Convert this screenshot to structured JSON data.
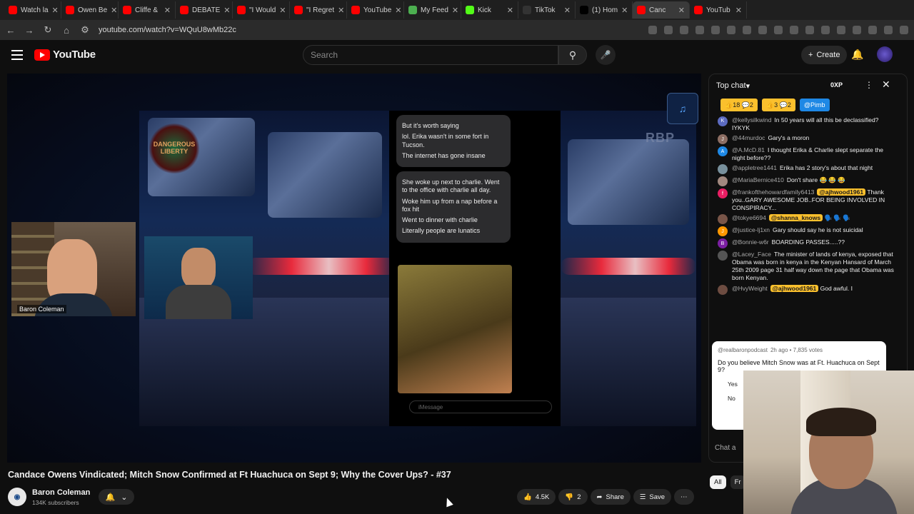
{
  "browser": {
    "tabs": [
      {
        "label": "Watch la",
        "color": "#ff0000"
      },
      {
        "label": "Owen Be",
        "color": "#ff0000"
      },
      {
        "label": "Cliffe &",
        "color": "#ff0000"
      },
      {
        "label": "DEBATE",
        "color": "#ff0000"
      },
      {
        "label": "\"I Would",
        "color": "#ff0000"
      },
      {
        "label": "\"I Regret",
        "color": "#ff0000"
      },
      {
        "label": "YouTube",
        "color": "#ff0000"
      },
      {
        "label": "My Feed",
        "color": "#4caf50"
      },
      {
        "label": "Kick",
        "color": "#53fc18"
      },
      {
        "label": "TikTok",
        "color": "#333333"
      },
      {
        "label": "(1) Hom",
        "color": "#000000"
      },
      {
        "label": "Canc",
        "color": "#ff0000"
      },
      {
        "label": "YouTub",
        "color": "#ff0000"
      }
    ],
    "url": "youtube.com/watch?v=WQuU8wMb22c"
  },
  "header": {
    "logo": "YouTube",
    "search_placeholder": "Search",
    "create_label": "Create"
  },
  "video": {
    "brand": "DANGEROUS LIBERTY",
    "watermark": "RBP",
    "cam1_label": "Baron Coleman",
    "phone": {
      "bubble1": [
        "But it's worth saying",
        "lol. Erika wasn't in some fort in Tucson.",
        "The internet has gone insane"
      ],
      "bubble2": [
        "She woke up next to charlie. Went to the office with charlie all day.",
        "Woke him up from a nap before a fox hit",
        "Went to dinner with charlie",
        "Literally people are lunatics"
      ],
      "imessage": "iMessage"
    }
  },
  "meta": {
    "title": "Candace Owens Vindicated; Mitch Snow Confirmed at Ft Huachuca on Sept 9; Why the Cover Ups? - #37",
    "channel": "Baron Coleman",
    "subscribers": "134K subscribers",
    "likes": "4.5K",
    "dislikes": "2",
    "share": "Share",
    "save": "Save"
  },
  "chat": {
    "header": "Top chat",
    "xp": "0XP",
    "pins": [
      {
        "text": "👍18 💬2",
        "color": "#fbc02d"
      },
      {
        "text": "👍3 💬2",
        "color": "#fbc02d"
      },
      {
        "text": "@Pimb",
        "color": "#1e88e5"
      }
    ],
    "messages": [
      {
        "user": "@kellysilkwind",
        "text": "In 50 years will all this be declassified? IYKYK",
        "av": "K",
        "color": "#5c6bc0"
      },
      {
        "user": "@44murdoc",
        "text": "Gary's a moron",
        "av": "J",
        "color": "#8d6e63"
      },
      {
        "user": "@A.McD.81",
        "text": "I thought Erika & Charlie slept separate the night before??",
        "av": "A",
        "color": "#1e88e5"
      },
      {
        "user": "@appletree1441",
        "text": "Erika has 2 story's about that night",
        "av": "",
        "color": "#78909c"
      },
      {
        "user": "@MariaBernice410",
        "text": "Don't share 😂 😂 😂",
        "av": "",
        "color": "#a1887f"
      },
      {
        "user": "@frankofthehowardfamily6413",
        "tag": "@ajhwood1961",
        "text": "Thank you..GARY AWESOME JOB..FOR BEING INVOLVED IN CONSPIRACY...",
        "av": "f",
        "color": "#e91e63"
      },
      {
        "user": "@tokye6694",
        "tag": "@shanna_knows",
        "text": "🗣️ 🗣️ 🗣️",
        "av": "",
        "color": "#795548"
      },
      {
        "user": "@justice-lj1xn",
        "text": "Gary should say he is not suicidal",
        "av": "J",
        "color": "#ff9800"
      },
      {
        "user": "@Bonnie-w6r",
        "text": "BOARDING PASSES.....??",
        "av": "B",
        "color": "#7b1fa2"
      },
      {
        "user": "@Lacey_Face",
        "text": "The minister of lands of kenya, exposed that Obama was born in kenya in the Kenyan Hansard of March 25th 2009 page 31 half way down the page that Obama was born Kenyan.",
        "av": "",
        "color": "#555555"
      },
      {
        "user": "@HvyWeight",
        "tag": "@ajhwood1961",
        "text": "God awful. I",
        "av": "",
        "color": "#6d4c41"
      }
    ],
    "poll": {
      "author": "@realbaronpodcast",
      "meta": "2h ago • 7,835 votes",
      "question": "Do you believe Mitch Snow was at Ft. Huachuca on Sept 9?",
      "options": [
        "Yes",
        "No"
      ]
    },
    "input_label": "Chat a",
    "filters": [
      "All",
      "Fr"
    ]
  }
}
